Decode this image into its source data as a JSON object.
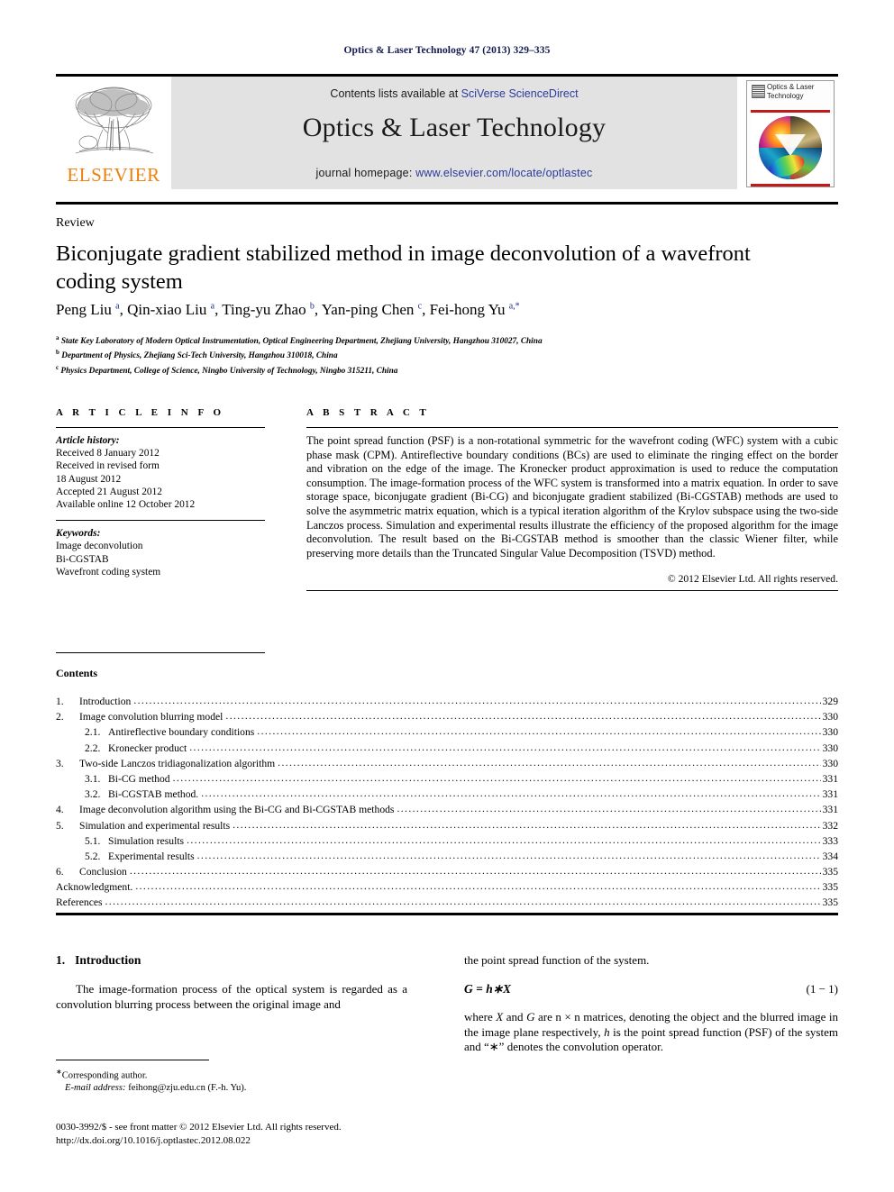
{
  "running_head": "Optics & Laser Technology 47 (2013) 329–335",
  "masthead": {
    "contents_prefix": "Contents lists available at ",
    "contents_link": "SciVerse ScienceDirect",
    "journal_title": "Optics & Laser Technology",
    "homepage_prefix": "journal homepage: ",
    "homepage_url": "www.elsevier.com/locate/optlastec",
    "publisher_wordmark": "ELSEVIER",
    "cover_journal_name": "Optics & Laser Technology",
    "accent_link_color": "#2b3a9c",
    "band_color": "#e2e2e2",
    "elsevier_orange": "#f07f09",
    "cover_rule_color": "#c01a1a"
  },
  "article": {
    "kicker": "Review",
    "title": "Biconjugate gradient stabilized method in image deconvolution of a wavefront coding system",
    "authors_html": "Peng Liu <sup>a</sup>, Qin-xiao Liu <sup>a</sup>, Ting-yu Zhao <sup>b</sup>, Yan-ping Chen <sup>c</sup>, Fei-hong Yu <sup>a,*</sup>",
    "affiliations": [
      {
        "marker": "a",
        "text": "State Key Laboratory of Modern Optical Instrumentation, Optical Engineering Department, Zhejiang University, Hangzhou 310027, China"
      },
      {
        "marker": "b",
        "text": "Department of Physics, Zhejiang Sci-Tech University, Hangzhou 310018, China"
      },
      {
        "marker": "c",
        "text": "Physics Department, College of Science, Ningbo University of Technology, Ningbo 315211, China"
      }
    ]
  },
  "article_info": {
    "heading": "A R T I C L E   I N F O",
    "history_label": "Article history:",
    "history": [
      "Received 8 January 2012",
      "Received in revised form",
      "18 August 2012",
      "Accepted 21 August 2012",
      "Available online 12 October 2012"
    ],
    "keywords_label": "Keywords:",
    "keywords": [
      "Image deconvolution",
      "Bi-CGSTAB",
      "Wavefront coding system"
    ]
  },
  "abstract": {
    "heading": "A B S T R A C T",
    "text": "The point spread function (PSF) is a non-rotational symmetric for the wavefront coding (WFC) system with a cubic phase mask (CPM). Antireflective boundary conditions (BCs) are used to eliminate the ringing effect on the border and vibration on the edge of the image. The Kronecker product approximation is used to reduce the computation consumption. The image-formation process of the WFC system is transformed into a matrix equation. In order to save storage space, biconjugate gradient (Bi-CG) and biconjugate gradient stabilized (Bi-CGSTAB) methods are used to solve the asymmetric matrix equation, which is a typical iteration algorithm of the Krylov subspace using the two-side Lanczos process. Simulation and experimental results illustrate the efficiency of the proposed algorithm for the image deconvolution. The result based on the Bi-CGSTAB method is smoother than the classic Wiener filter, while preserving more details than the Truncated Singular Value Decomposition (TSVD) method.",
    "copyright": "© 2012 Elsevier Ltd. All rights reserved."
  },
  "contents": {
    "heading": "Contents",
    "entries": [
      {
        "level": 1,
        "num": "1.",
        "label": "Introduction",
        "page": "329"
      },
      {
        "level": 1,
        "num": "2.",
        "label": "Image convolution blurring model",
        "page": "330"
      },
      {
        "level": 2,
        "num": "2.1.",
        "label": "Antireflective boundary conditions",
        "page": "330"
      },
      {
        "level": 2,
        "num": "2.2.",
        "label": "Kronecker product",
        "page": "330"
      },
      {
        "level": 1,
        "num": "3.",
        "label": "Two-side Lanczos tridiagonalization algorithm",
        "page": "330"
      },
      {
        "level": 2,
        "num": "3.1.",
        "label": "Bi-CG method",
        "page": "331"
      },
      {
        "level": 2,
        "num": "3.2.",
        "label": "Bi-CGSTAB method.",
        "page": "331"
      },
      {
        "level": 1,
        "num": "4.",
        "label": "Image deconvolution algorithm using the Bi-CG and Bi-CGSTAB methods",
        "page": "331"
      },
      {
        "level": 1,
        "num": "5.",
        "label": "Simulation and experimental results",
        "page": "332"
      },
      {
        "level": 2,
        "num": "5.1.",
        "label": "Simulation results",
        "page": "333"
      },
      {
        "level": 2,
        "num": "5.2.",
        "label": "Experimental results",
        "page": "334"
      },
      {
        "level": 1,
        "num": "6.",
        "label": "Conclusion",
        "page": "335"
      },
      {
        "level": 0,
        "num": "",
        "label": "Acknowledgment.",
        "page": "335"
      },
      {
        "level": 0,
        "num": "",
        "label": "References",
        "page": "335"
      }
    ]
  },
  "body": {
    "section_number": "1.",
    "section_title": "Introduction",
    "left_paragraph": "The image-formation process of the optical system is regarded as a convolution blurring process between the original image and",
    "right_lead": "the point spread function of the system.",
    "equation": "G = h∗X",
    "equation_number": "(1 − 1)",
    "right_paragraph": "where X and G are n × n matrices, denoting the object and the blurred image in the image plane respectively, h is the point spread function (PSF) of the system and “∗” denotes the convolution operator."
  },
  "footer": {
    "corresponding_author": "Corresponding author.",
    "email_label": "E-mail address:",
    "email_value": "feihong@zju.edu.cn (F.-h. Yu).",
    "issn_line": "0030-3992/$ - see front matter © 2012 Elsevier Ltd. All rights reserved.",
    "doi_line": "http://dx.doi.org/10.1016/j.optlastec.2012.08.022"
  }
}
